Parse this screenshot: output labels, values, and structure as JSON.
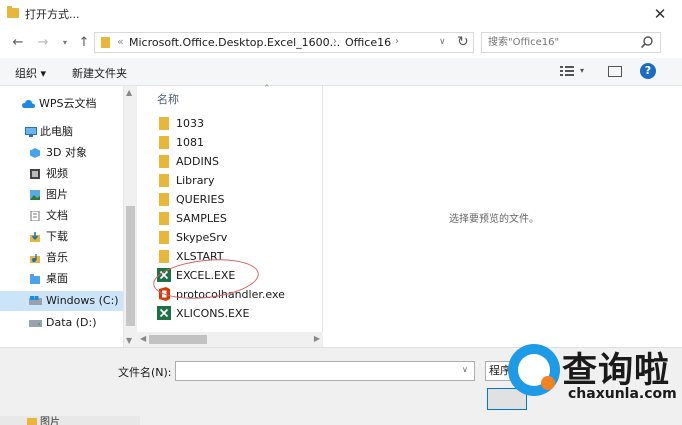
{
  "window": {
    "title": "打开方式...",
    "close_glyph": "✕"
  },
  "address": {
    "path_prefix": "«",
    "segments": [
      "Microsoft.Office.Desktop.Excel_1600...",
      "Office16"
    ],
    "search_placeholder": "搜索\"Office16\""
  },
  "toolbar": {
    "organize": "组织 ▾",
    "new_folder": "新建文件夹",
    "help": "?"
  },
  "nav": {
    "items": [
      {
        "label": "WPS云文档",
        "icon": "cloud-icon"
      },
      {
        "label": "此电脑",
        "icon": "computer-icon"
      },
      {
        "label": "3D 对象",
        "icon": "3d-objects-icon"
      },
      {
        "label": "视频",
        "icon": "video-icon"
      },
      {
        "label": "图片",
        "icon": "pictures-icon"
      },
      {
        "label": "文档",
        "icon": "documents-icon"
      },
      {
        "label": "下载",
        "icon": "downloads-icon"
      },
      {
        "label": "音乐",
        "icon": "music-icon"
      },
      {
        "label": "桌面",
        "icon": "desktop-icon"
      },
      {
        "label": "Windows (C:)",
        "icon": "drive-icon",
        "selected": true
      },
      {
        "label": "Data (D:)",
        "icon": "drive-icon"
      }
    ]
  },
  "files": {
    "column_name": "名称",
    "items": [
      {
        "name": "1033",
        "type": "folder"
      },
      {
        "name": "1081",
        "type": "folder"
      },
      {
        "name": "ADDINS",
        "type": "folder"
      },
      {
        "name": "Library",
        "type": "folder"
      },
      {
        "name": "QUERIES",
        "type": "folder"
      },
      {
        "name": "SAMPLES",
        "type": "folder"
      },
      {
        "name": "SkypeSrv",
        "type": "folder"
      },
      {
        "name": "XLSTART",
        "type": "folder"
      },
      {
        "name": "EXCEL.EXE",
        "type": "excel"
      },
      {
        "name": "protocolhandler.exe",
        "type": "office"
      },
      {
        "name": "XLICONS.EXE",
        "type": "excel"
      }
    ]
  },
  "preview": {
    "message": "选择要预览的文件。"
  },
  "bottom": {
    "filename_label": "文件名(N):",
    "filename_value": "",
    "type_button": "程序"
  },
  "strip": {
    "label": "图片"
  },
  "watermark": {
    "text_cn": "查询啦",
    "text_en": "chaxunla.com"
  },
  "colors": {
    "folder": "#e8b73a",
    "selection": "#cce4f7",
    "accent": "#0078d7",
    "excel_green": "#1e7145",
    "office_orange": "#d83b01"
  }
}
